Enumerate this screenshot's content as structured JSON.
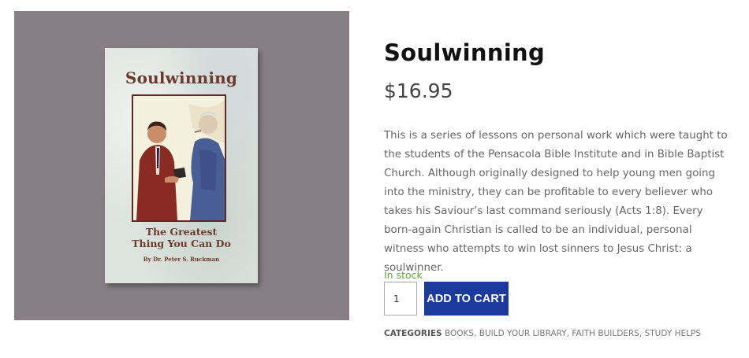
{
  "product": {
    "title": "Soulwinning",
    "price": "$16.95",
    "description": "This is a series of lessons on personal work which were taught to the students of the Pensacola Bible Institute and in Bible Baptist Church. Although originally designed to help young men going into the ministry, they can be profitable to every believer who takes his Saviour’s last command seriously (Acts 1:8). Every born-again Christian is called to be an individual, personal witness who attempts to win lost sinners to Jesus Christ: a soulwinner.",
    "stock_status": "In stock",
    "quantity": "1",
    "add_to_cart_label": "ADD TO CART"
  },
  "cover": {
    "title": "Soulwinning",
    "subtitle_line1": "The Greatest",
    "subtitle_line2": "Thing You Can Do",
    "author": "By Dr. Peter S. Ruckman"
  },
  "meta": {
    "categories_label": "CATEGORIES",
    "categories": [
      "BOOKS",
      "BUILD YOUR LIBRARY",
      "FAITH BUILDERS",
      "STUDY HELPS"
    ]
  },
  "colors": {
    "button": "#1c3a9e",
    "in_stock": "#5aa83a",
    "gallery_bg": "#877f84"
  }
}
